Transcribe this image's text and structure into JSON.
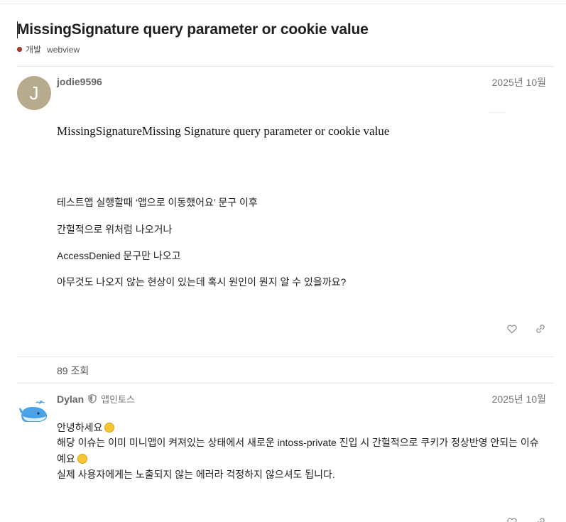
{
  "topic": {
    "title": "MissingSignature query parameter or cookie value",
    "category": "개발",
    "tag": "webview"
  },
  "post1": {
    "avatar_letter": "J",
    "username": "jodie9596",
    "date": "2025년 10월",
    "signature_text": "MissingSignatureMissing Signature query parameter or cookie value",
    "lines": [
      "테스트앱 실행할때 ‘앱으로 이동했어요’ 문구 이후",
      "간헐적으로 위처럼 나오거나",
      "AccessDenied 문구만 나오고",
      "아무것도 나오지 않는 현상이 있는데 혹시 원인이 뭔지 알 수 있을까요?"
    ]
  },
  "views": "89 조회",
  "post2": {
    "username": "Dylan",
    "group": "앱인토스",
    "date": "2025년 10월",
    "line1": "안녕하세요",
    "line2": "해당 이슈는 이미 미니앱이 켜져있는 상태에서 새로운 intoss-private 진입 시 간헐적으로 쿠키가 정상반영 안되는 이슈",
    "line3": "예요",
    "line4": "실제 사용자에게는 노출되지 않는 에러라 걱정하지 않으셔도 됩니다."
  },
  "icons": {
    "like": "heart-icon",
    "link": "link-icon",
    "role": "shield-icon",
    "avatar2": "whale-avatar"
  },
  "colors": {
    "category": "#b03a2e",
    "avatar_j": "#b7ab8e",
    "whale": "#4aa3e8"
  }
}
